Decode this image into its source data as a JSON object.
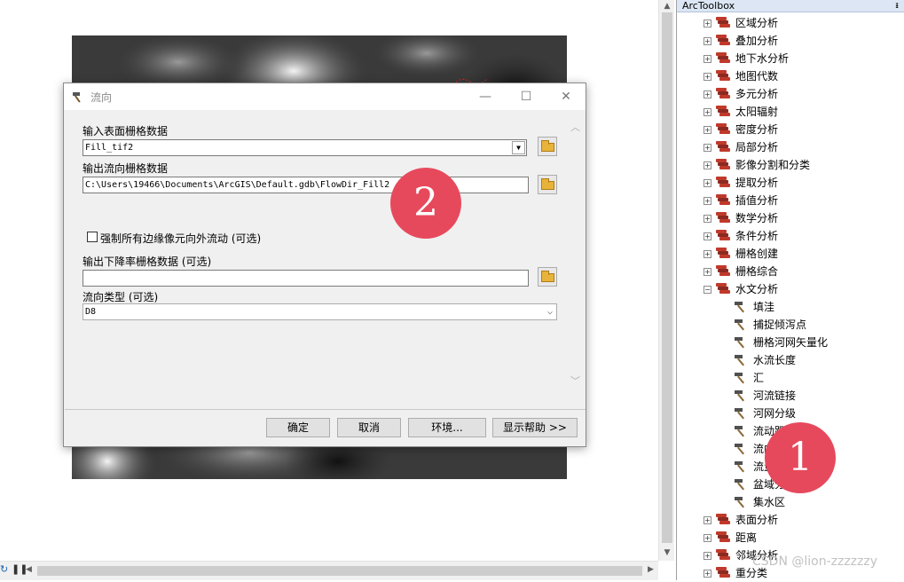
{
  "toolbox": {
    "title": "ArcToolbox",
    "pin": "ᵻ",
    "items": [
      {
        "label": "区域分析",
        "expanded": false
      },
      {
        "label": "叠加分析",
        "expanded": false
      },
      {
        "label": "地下水分析",
        "expanded": false
      },
      {
        "label": "地图代数",
        "expanded": false
      },
      {
        "label": "多元分析",
        "expanded": false
      },
      {
        "label": "太阳辐射",
        "expanded": false
      },
      {
        "label": "密度分析",
        "expanded": false
      },
      {
        "label": "局部分析",
        "expanded": false
      },
      {
        "label": "影像分割和分类",
        "expanded": false
      },
      {
        "label": "提取分析",
        "expanded": false
      },
      {
        "label": "插值分析",
        "expanded": false
      },
      {
        "label": "数学分析",
        "expanded": false
      },
      {
        "label": "条件分析",
        "expanded": false
      },
      {
        "label": "栅格创建",
        "expanded": false
      },
      {
        "label": "栅格综合",
        "expanded": false
      },
      {
        "label": "水文分析",
        "expanded": true
      }
    ],
    "hydro_tools": [
      "填洼",
      "捕捉倾泻点",
      "栅格河网矢量化",
      "水流长度",
      "汇",
      "河流链接",
      "河网分级",
      "流动距",
      "流向",
      "流量",
      "盆域分",
      "集水区"
    ],
    "items_after": [
      {
        "label": "表面分析"
      },
      {
        "label": "距离"
      },
      {
        "label": "邻域分析"
      },
      {
        "label": "重分类"
      }
    ]
  },
  "dialog": {
    "title": "流向",
    "input_label": "输入表面栅格数据",
    "input_value": "Fill_tif2",
    "output_label": "输出流向栅格数据",
    "output_value": "C:\\Users\\19466\\Documents\\ArcGIS\\Default.gdb\\FlowDir_Fill2",
    "force_edge_label": "强制所有边缘像元向外流动 (可选)",
    "force_edge_checked": false,
    "drop_label": "输出下降率栅格数据 (可选)",
    "drop_value": "",
    "flow_type_label": "流向类型 (可选)",
    "flow_type_value": "D8",
    "buttons": {
      "ok": "确定",
      "cancel": "取消",
      "env": "环境...",
      "help": "显示帮助 >>"
    }
  },
  "badges": {
    "one": "1",
    "two": "2"
  },
  "watermark": "CSDN @lion-zzzzzzy",
  "colors": {
    "badge": "#e7495c",
    "toolbox_icon_red": "#c0392b"
  }
}
